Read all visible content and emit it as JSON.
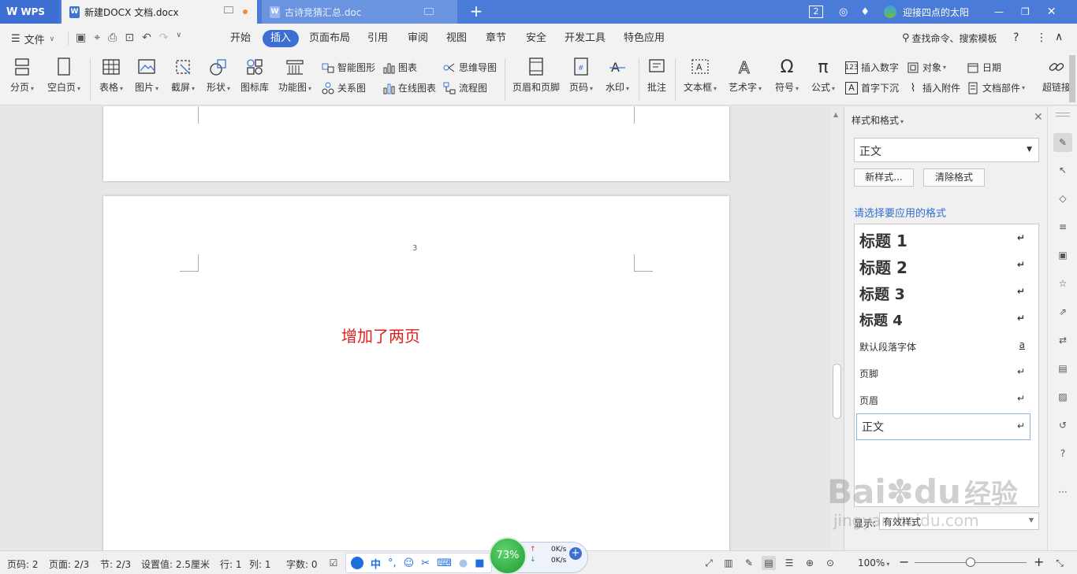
{
  "titlebar": {
    "wps_label": "WPS",
    "tabs": [
      {
        "label": "新建DOCX 文档.docx",
        "active": true
      },
      {
        "label": "古诗竞猜汇总.doc",
        "active": false
      }
    ],
    "badge": "2",
    "user_name": "迎接四点的太阳"
  },
  "menubar": {
    "file_label": "文件",
    "items": [
      "开始",
      "插入",
      "页面布局",
      "引用",
      "审阅",
      "视图",
      "章节",
      "安全",
      "开发工具",
      "特色应用"
    ],
    "active_item": "插入",
    "search_label": "查找命令、搜索模板"
  },
  "ribbon": {
    "page_break": "分页",
    "blank_page": "空白页",
    "table": "表格",
    "picture": "图片",
    "screenshot": "截屏",
    "shape": "形状",
    "icon_lib": "图标库",
    "func_chart": "功能图",
    "smart_art": "智能图形",
    "relation": "关系图",
    "chart": "图表",
    "online_chart": "在线图表",
    "mind_map": "思维导图",
    "flow_chart": "流程图",
    "header_footer": "页眉和页脚",
    "page_num": "页码",
    "watermark": "水印",
    "comment": "批注",
    "textbox": "文本框",
    "wordart": "艺术字",
    "symbol": "符号",
    "formula": "公式",
    "insert_number": "插入数字",
    "object": "对象",
    "date": "日期",
    "drop_cap": "首字下沉",
    "attachment": "插入附件",
    "doc_parts": "文档部件",
    "hyperlink": "超链接"
  },
  "document": {
    "page_number": "3",
    "body_text": "增加了两页",
    "body_color": "#e02020"
  },
  "panel": {
    "title": "样式和格式",
    "current_style": "正文",
    "new_style_btn": "新样式...",
    "clear_format_btn": "清除格式",
    "prompt": "请选择要应用的格式",
    "styles": [
      {
        "label": "标题  1",
        "mark": "↵"
      },
      {
        "label": "标题  2",
        "mark": "↵"
      },
      {
        "label": "标题  3",
        "mark": "↵"
      },
      {
        "label": "标题  4",
        "mark": "↵"
      },
      {
        "label": "默认段落字体",
        "mark": "a"
      },
      {
        "label": "页脚",
        "mark": "↵"
      },
      {
        "label": "页眉",
        "mark": "↵"
      },
      {
        "label": "正文",
        "mark": "↵"
      }
    ],
    "show_label": "显示:",
    "show_value": "有效样式"
  },
  "statusbar": {
    "page_no": "页码: 2",
    "page": "页面: 2/3",
    "section": "节: 2/3",
    "setting": "设置值: 2.5厘米",
    "row": "行: 1",
    "col": "列: 1",
    "words": "字数: 0",
    "zoom": "100%",
    "ime_cn": "中",
    "net_percent": "73%",
    "upload": "0K/s",
    "download": "0K/s"
  },
  "watermark": {
    "brand": "Bai",
    "brand2": "du",
    "cn": "经验",
    "url": "jingyan.baidu.com"
  },
  "colors": {
    "accent": "#3d6fd2",
    "titlebar": "#4a7bd8"
  }
}
